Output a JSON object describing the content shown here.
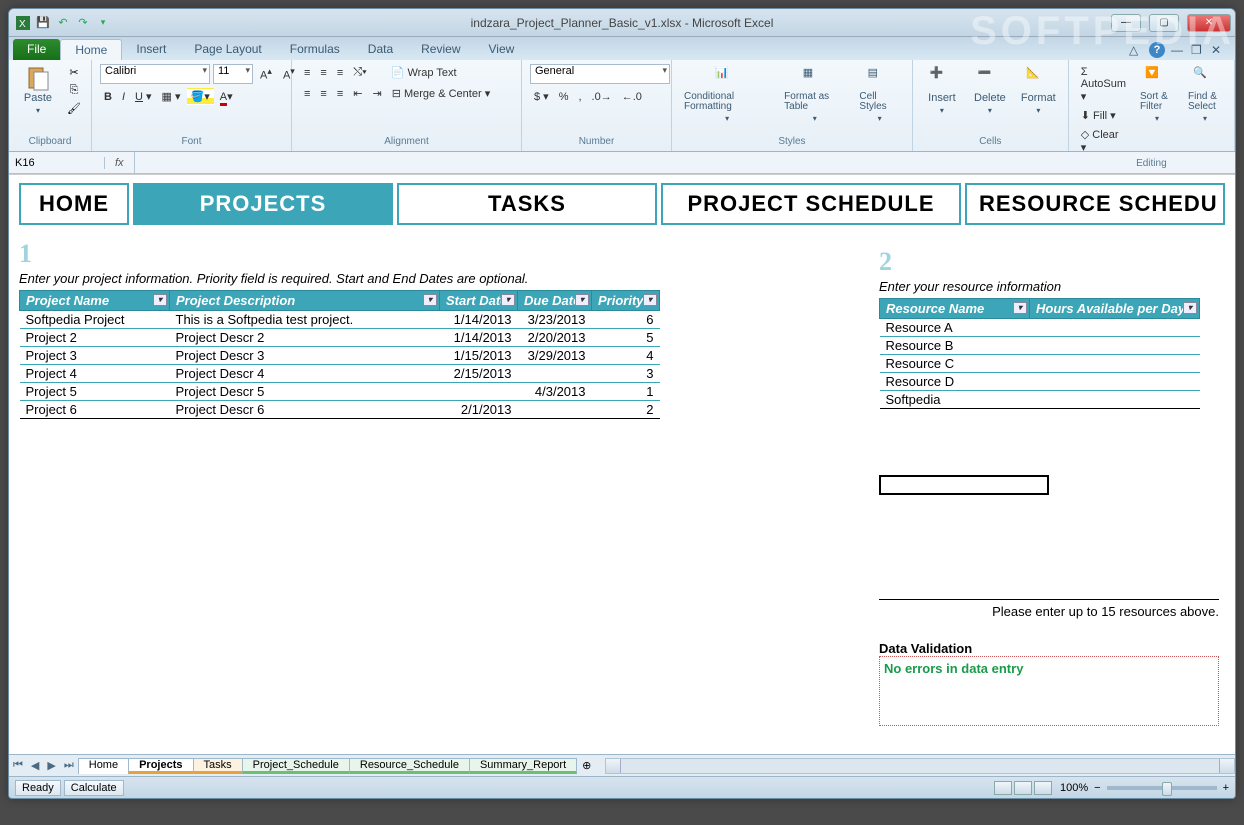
{
  "titlebar": {
    "title": "indzara_Project_Planner_Basic_v1.xlsx - Microsoft Excel"
  },
  "ribbon": {
    "file": "File",
    "tabs": [
      "Home",
      "Insert",
      "Page Layout",
      "Formulas",
      "Data",
      "Review",
      "View"
    ],
    "active_tab": "Home",
    "groups": {
      "clipboard": {
        "label": "Clipboard",
        "paste": "Paste"
      },
      "font": {
        "label": "Font",
        "name": "Calibri",
        "size": "11"
      },
      "alignment": {
        "label": "Alignment",
        "wrap": "Wrap Text",
        "merge": "Merge & Center"
      },
      "number": {
        "label": "Number",
        "format": "General"
      },
      "styles": {
        "label": "Styles",
        "cond": "Conditional Formatting",
        "table": "Format as Table",
        "cell": "Cell Styles"
      },
      "cells": {
        "label": "Cells",
        "insert": "Insert",
        "delete": "Delete",
        "format": "Format"
      },
      "editing": {
        "label": "Editing",
        "autosum": "AutoSum",
        "fill": "Fill",
        "clear": "Clear",
        "sort": "Sort & Filter",
        "find": "Find & Select"
      }
    }
  },
  "formula_bar": {
    "cell_ref": "K16",
    "fx": "fx"
  },
  "nav": {
    "home": "HOME",
    "projects": "PROJECTS",
    "tasks": "TASKS",
    "schedule": "PROJECT SCHEDULE",
    "resource": "RESOURCE SCHEDU"
  },
  "section1": {
    "num": "1",
    "instruction": "Enter your project information. Priority field is required. Start and End Dates are optional.",
    "headers": [
      "Project Name",
      "Project Description",
      "Start Date",
      "Due Date",
      "Priority"
    ],
    "rows": [
      [
        "Softpedia Project",
        "This is a Softpedia test project.",
        "1/14/2013",
        "3/23/2013",
        "6"
      ],
      [
        "Project 2",
        "Project Descr 2",
        "1/14/2013",
        "2/20/2013",
        "5"
      ],
      [
        "Project 3",
        "Project Descr 3",
        "1/15/2013",
        "3/29/2013",
        "4"
      ],
      [
        "Project 4",
        "Project Descr 4",
        "2/15/2013",
        "",
        "3"
      ],
      [
        "Project 5",
        "Project Descr 5",
        "",
        "4/3/2013",
        "1"
      ],
      [
        "Project 6",
        "Project Descr 6",
        "2/1/2013",
        "",
        "2"
      ]
    ]
  },
  "section2": {
    "num": "2",
    "instruction": "Enter your resource information",
    "headers": [
      "Resource Name",
      "Hours Available per Day"
    ],
    "rows": [
      [
        "Resource A",
        ""
      ],
      [
        "Resource B",
        ""
      ],
      [
        "Resource C",
        ""
      ],
      [
        "Resource D",
        ""
      ],
      [
        "Softpedia",
        ""
      ]
    ],
    "note": "Please enter up to 15 resources above.",
    "dv_header": "Data Validation",
    "dv_msg": "No errors in data entry"
  },
  "sheet_tabs": {
    "items": [
      {
        "label": "Home",
        "color": ""
      },
      {
        "label": "Projects",
        "color": "#e8a23a",
        "active": true
      },
      {
        "label": "Tasks",
        "color": "#e8a23a"
      },
      {
        "label": "Project_Schedule",
        "color": "#6fbf73"
      },
      {
        "label": "Resource_Schedule",
        "color": "#6fbf73"
      },
      {
        "label": "Summary_Report",
        "color": "#6fbf73"
      }
    ]
  },
  "status": {
    "ready": "Ready",
    "calc": "Calculate",
    "zoom": "100%",
    "minus": "−",
    "plus": "+"
  },
  "watermark": "SOFTPEDIA"
}
